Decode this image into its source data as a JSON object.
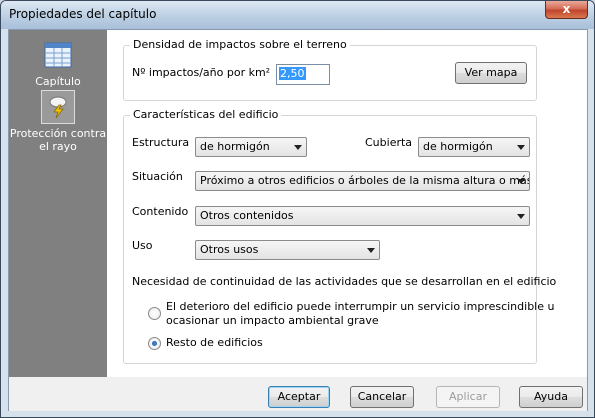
{
  "window": {
    "title": "Propiedades del capítulo",
    "close_glyph": "x"
  },
  "sidebar": {
    "items": [
      {
        "label": "Capítulo",
        "icon": "table-icon",
        "selected": false
      },
      {
        "label": "Protección contra el rayo",
        "icon": "lightning-icon",
        "selected": true
      }
    ]
  },
  "density": {
    "group_title": "Densidad de impactos sobre el terreno",
    "impacts_label": "Nº impactos/año por km²",
    "impacts_value": "2,50",
    "map_button": "Ver mapa"
  },
  "building": {
    "group_title": "Características del edificio",
    "estructura_label": "Estructura",
    "estructura_value": "de hormigón",
    "cubierta_label": "Cubierta",
    "cubierta_value": "de hormigón",
    "situacion_label": "Situación",
    "situacion_value": "Próximo a otros edificios o árboles de la misma altura o más altos",
    "contenido_label": "Contenido",
    "contenido_value": "Otros contenidos",
    "uso_label": "Uso",
    "uso_value": "Otros usos",
    "continuity_label": "Necesidad de continuidad de las actividades que se desarrollan en el edificio",
    "option1_line1": "El deterioro del edificio puede interrumpir un servicio imprescindible u",
    "option1_line2": "ocasionar un impacto ambiental grave",
    "option2": "Resto de edificios",
    "selected_option": "Resto de edificios"
  },
  "footer": {
    "accept": "Aceptar",
    "cancel": "Cancelar",
    "apply": "Aplicar",
    "help": "Ayuda"
  },
  "colors": {
    "selection": "#3399ff",
    "sidebar_bg": "#808080",
    "close_button": "#c8452d"
  }
}
